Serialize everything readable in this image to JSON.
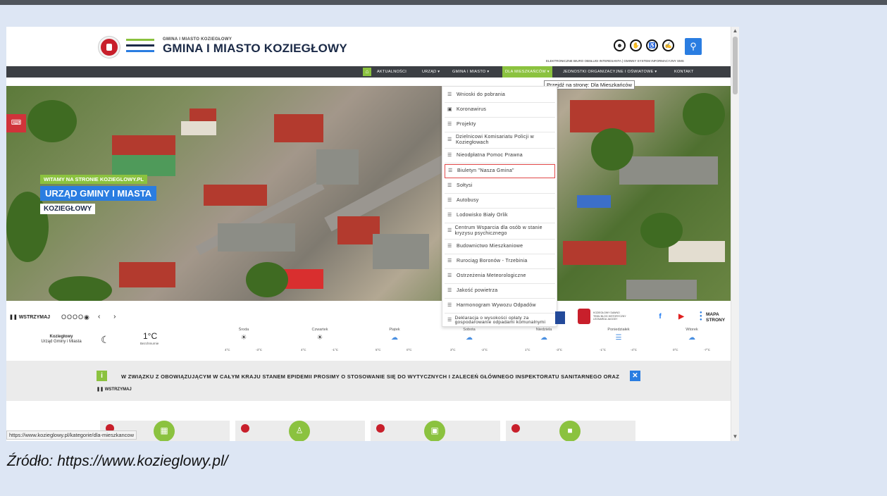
{
  "header": {
    "brand_small": "GMINA I MIASTO KOZIEGŁOWY",
    "brand_big": "GMINA I MIASTO KOZIEGŁOWY",
    "links_line": "ELEKTRONICZNE BIURO OBSŁUGI INTERESANTA  |  GMINNY SYSTEM INFORMACYJNY SMS"
  },
  "nav": {
    "items": [
      "AKTUALNOŚCI",
      "URZĄD ▾",
      "GMINA I MIASTO ▾",
      "DLA MIESZKAŃCÓW ▾",
      "JEDNOSTKI ORGANIZACYJNE I OŚWIATOWE ▾",
      "KONTAKT"
    ],
    "tooltip": "Przejdź na stronę: Dla Mieszkańców"
  },
  "hero": {
    "welcome": "WITAMY NA STRONIE KOZIEGLOWY.PL",
    "title1": "URZĄD GMINY I MIASTA",
    "title2": "KOZIEGŁOWY"
  },
  "dropdown": [
    "Wnioski do pobrania",
    "Koronawirus",
    "Projekty",
    "Dzielnicowi Komisariatu Policji w Koziegłowach",
    "Nieodpłatna Pomoc Prawna",
    "Biuletyn \"Nasza Gmina\"",
    "Sołtysi",
    "Autobusy",
    "Lodowisko Biały Orlik",
    "Centrum Wsparcia dla osób w stanie kryzysu psychicznego",
    "Budownictwo Mieszkaniowe",
    "Rurociąg Boronów - Trzebinia",
    "Ostrzeżenia Meteorologiczne",
    "Jakość powietrza",
    "Harmonogram Wywozu Odpadów",
    "Deklaracja o wysokości opłaty za gospodarowanie odpadami komunalnymi"
  ],
  "controls": {
    "pause": "WSTRZYMAJ",
    "dots": "OOOO◉",
    "arrows": "‹ ›"
  },
  "partners": {
    "logo_text": "KOZIEGŁOWY DAWNO TEMU BLOG HISTORYCZNY LEONARDA JAGODY",
    "mapa": "MAPA STRONY"
  },
  "weather": {
    "city": "Koziegłowy",
    "city_sub": "Urząd Gminy i Miasta",
    "temp": "1°C",
    "desc": "Bezchmurnie",
    "days": [
      {
        "name": "Środa",
        "icon": "☀",
        "hi": "4°C",
        "lo": "-3°C"
      },
      {
        "name": "Czwartek",
        "icon": "☀",
        "hi": "4°C",
        "lo": "-1°C"
      },
      {
        "name": "Piątek",
        "icon": "☁",
        "hi": "5°C",
        "lo": "0°C"
      },
      {
        "name": "Sobota",
        "icon": "☁",
        "hi": "3°C",
        "lo": "-2°C"
      },
      {
        "name": "Niedziela",
        "icon": "☁",
        "hi": "1°C",
        "lo": "-3°C"
      },
      {
        "name": "Poniedziałek",
        "icon": "☰",
        "hi": "-1°C",
        "lo": "-4°C"
      },
      {
        "name": "Wtorek",
        "icon": "☁",
        "hi": "0°C",
        "lo": "-7°C"
      }
    ]
  },
  "alert": {
    "text": "W ZWIĄZKU Z OBOWIĄZUJĄCYM W CAŁYM KRAJU STANEM EPIDEMII PROSIMY O STOSOWANIE SIĘ DO WYTYCZNYCH I ZALECEŃ GŁÓWNEGO INSPEKTORATU SANITARNEGO ORAZ",
    "pause": "WSTRZYMAJ"
  },
  "status_url": "https://www.kozieglowy.pl/kategorie/dla-mieszkancow",
  "caption": "Źródło: https://www.kozieglowy.pl/",
  "colors": {
    "accent_green": "#8bc23f",
    "accent_blue": "#2a7de1",
    "nav_bg": "#3c3f44",
    "crest_red": "#c81f2b"
  }
}
